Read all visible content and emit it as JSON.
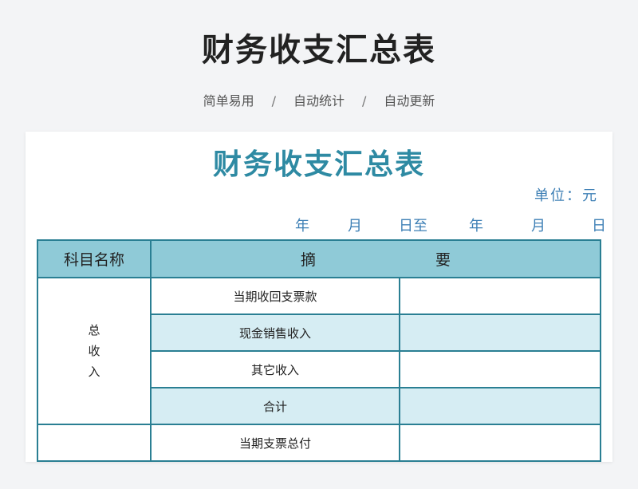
{
  "page": {
    "title": "财务收支汇总表",
    "tags": [
      "简单易用",
      "自动统计",
      "自动更新"
    ],
    "separator": "/"
  },
  "sheet": {
    "title": "财务收支汇总表",
    "unit": "单位：元",
    "date_labels": [
      "年",
      "月",
      "日至",
      "年",
      "月",
      "日"
    ],
    "headers": {
      "category": "科目名称",
      "summary_left": "摘",
      "summary_right": "要"
    },
    "groups": [
      {
        "category_chars": [
          "总",
          "收",
          "入"
        ],
        "rows": [
          {
            "item": "当期收回支票款",
            "value": "",
            "shaded": false
          },
          {
            "item": "现金销售收入",
            "value": "",
            "shaded": true
          },
          {
            "item": "其它收入",
            "value": "",
            "shaded": false
          },
          {
            "item": "合计",
            "value": "",
            "shaded": true
          }
        ]
      },
      {
        "category_chars": [],
        "rows": [
          {
            "item": "当期支票总付",
            "value": "",
            "shaded": false
          }
        ]
      }
    ]
  },
  "colors": {
    "accent": "#2e8aa3",
    "header_bg": "#8fcad7",
    "shade": "#d6edf3",
    "border": "#2a7f93",
    "date_text": "#3d7fb5"
  }
}
